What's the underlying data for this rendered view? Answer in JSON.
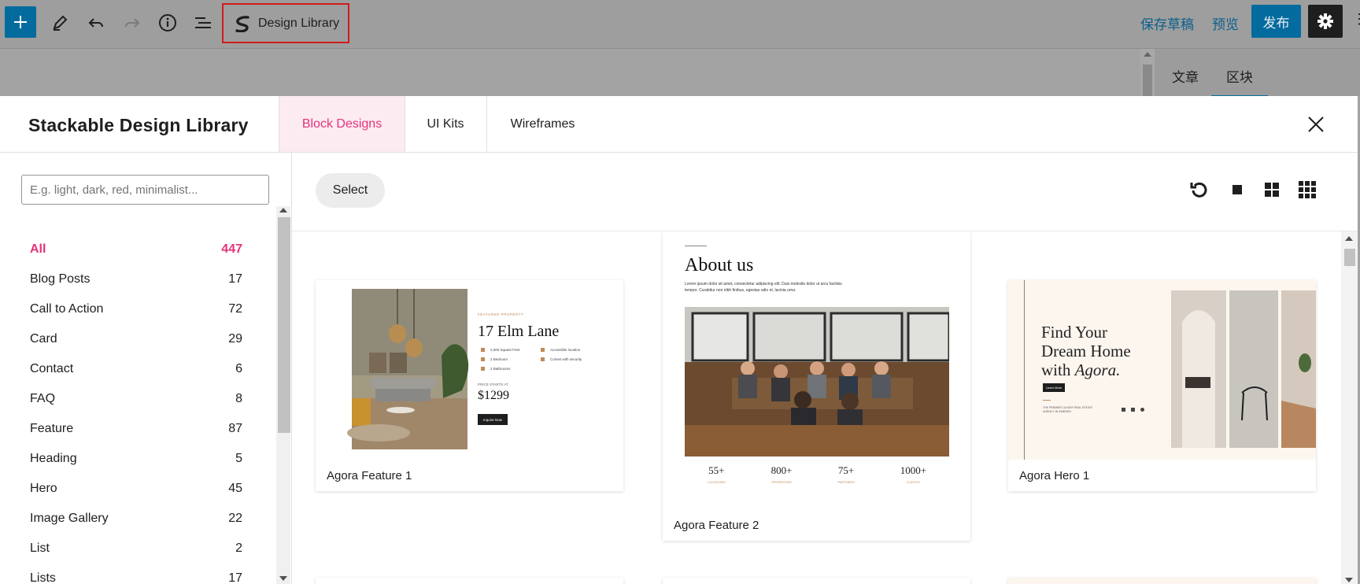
{
  "toolbar": {
    "design_library_label": "Design Library",
    "save_draft": "保存草稿",
    "preview": "预览",
    "publish": "发布"
  },
  "sidebar_panel": {
    "tabs": [
      "文章",
      "区块"
    ],
    "active_tab": "区块"
  },
  "modal": {
    "title": "Stackable Design Library",
    "tabs": [
      "Block Designs",
      "UI Kits",
      "Wireframes"
    ],
    "active_tab": "Block Designs"
  },
  "search": {
    "placeholder": "E.g. light, dark, red, minimalist..."
  },
  "categories": [
    {
      "label": "All",
      "count": "447"
    },
    {
      "label": "Blog Posts",
      "count": "17"
    },
    {
      "label": "Call to Action",
      "count": "72"
    },
    {
      "label": "Card",
      "count": "29"
    },
    {
      "label": "Contact",
      "count": "6"
    },
    {
      "label": "FAQ",
      "count": "8"
    },
    {
      "label": "Feature",
      "count": "87"
    },
    {
      "label": "Heading",
      "count": "5"
    },
    {
      "label": "Hero",
      "count": "45"
    },
    {
      "label": "Image Gallery",
      "count": "22"
    },
    {
      "label": "List",
      "count": "2"
    },
    {
      "label": "Lists",
      "count": "17"
    }
  ],
  "main_toolbar": {
    "select_label": "Select"
  },
  "designs": [
    {
      "name": "Agora Feature 1",
      "preview": {
        "eyebrow": "FEATURED PROPERTY",
        "title": "17 Elm Lane",
        "details": [
          "2,000 Square Feet",
          "Accessible location",
          "2 Bedroom",
          "Comes with security",
          "2 Bathrooms"
        ],
        "price_label": "PRICE STARTS AT",
        "price": "$1299",
        "button": "Inquire Now"
      }
    },
    {
      "name": "Agora Feature 2",
      "preview": {
        "title": "About us",
        "body": "Lorem ipsum dolor sit amet, consectetur adipiscing elit. Duis molestie dolor ut arcu facilisis tempor. Curabitur non nibh finibus, egestas odio et, lacinia urna.",
        "stats": [
          {
            "value": "55+",
            "label": "LOCATIONS"
          },
          {
            "value": "800+",
            "label": "PROPERTIES"
          },
          {
            "value": "75+",
            "label": "PARTNERS"
          },
          {
            "value": "1000+",
            "label": "CLIENTS"
          }
        ]
      }
    },
    {
      "name": "Agora Hero 1",
      "preview": {
        "title_1": "Find Your",
        "title_2": "Dream Home",
        "title_3": "with ",
        "title_brand": "Agora.",
        "button": "Learn More",
        "footer": "THE PREMIER LUXURY REAL ESTATE AGENCY IN SWEDEN"
      }
    }
  ],
  "colors": {
    "accent": "#e5337b",
    "wp_blue": "#036b9e",
    "active_tab_bg": "#fcebf1"
  }
}
